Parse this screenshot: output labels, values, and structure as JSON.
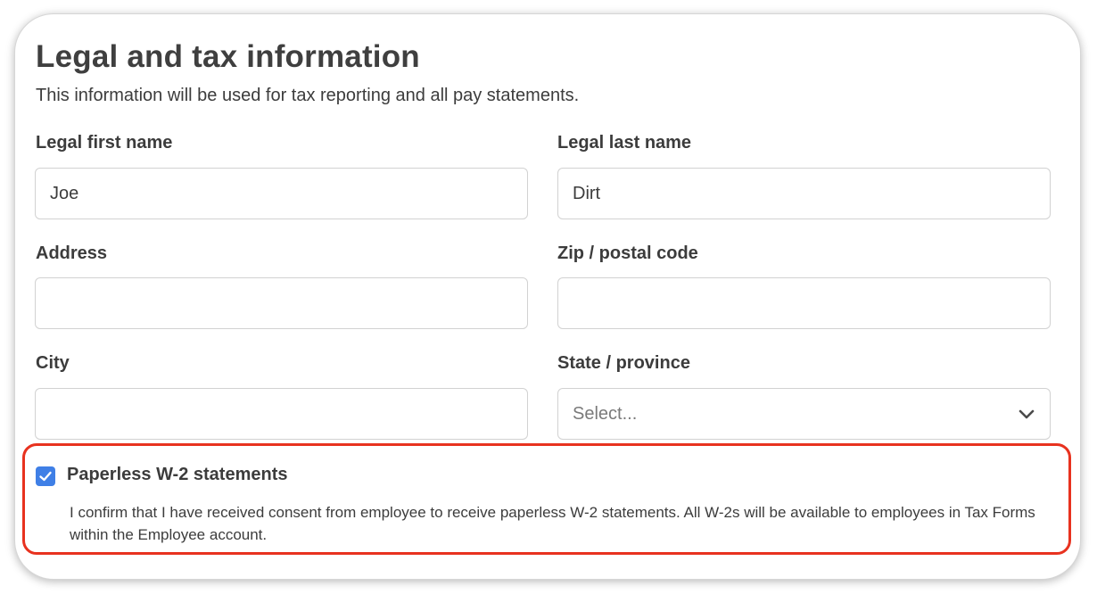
{
  "section": {
    "title": "Legal and tax information",
    "subtitle": "This information will be used for tax reporting and all pay statements."
  },
  "fields": {
    "first_name": {
      "label": "Legal first name",
      "value": "Joe"
    },
    "last_name": {
      "label": "Legal last name",
      "value": "Dirt"
    },
    "address": {
      "label": "Address",
      "value": ""
    },
    "zip": {
      "label": "Zip / postal code",
      "value": ""
    },
    "city": {
      "label": "City",
      "value": ""
    },
    "state": {
      "label": "State / province",
      "placeholder": "Select..."
    }
  },
  "paperless": {
    "checked": true,
    "label": "Paperless W-2 statements",
    "description": "I confirm that I have received consent from employee to receive paperless W-2 statements. All W-2s will be available to employees in Tax Forms within the Employee account."
  },
  "colors": {
    "checkbox": "#3f7fe6",
    "highlight_border": "#e8321f",
    "input_border": "#d2d2d2"
  },
  "icons": {
    "checkbox": "checkmark-icon",
    "select": "chevron-down-icon"
  }
}
